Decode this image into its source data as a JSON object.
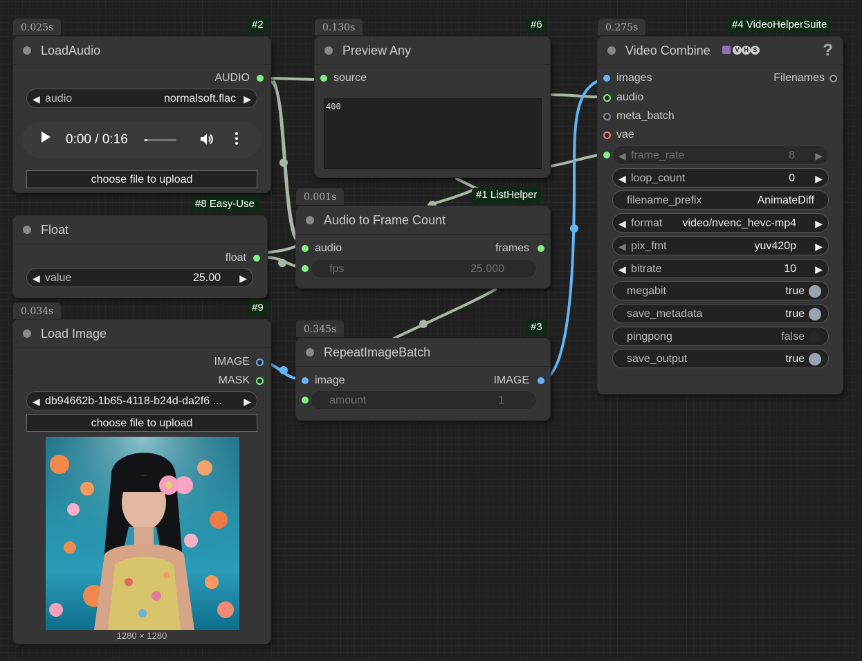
{
  "nodes": {
    "load_audio": {
      "time": "0.025s",
      "badge": "#2",
      "title": "LoadAudio",
      "output": "AUDIO",
      "audio_label": "audio",
      "audio_value": "normalsoft.flac",
      "player_time": "0:00 / 0:16",
      "upload_label": "choose file to upload"
    },
    "preview_any": {
      "time": "0.130s",
      "badge": "#6",
      "title": "Preview Any",
      "input": "source",
      "text": "400"
    },
    "float": {
      "badge": "#8 Easy-Use",
      "title": "Float",
      "output": "float",
      "value_label": "value",
      "value": "25.00"
    },
    "audio_to_frame": {
      "time": "0.001s",
      "badge": "#1 ListHelper",
      "title": "Audio to Frame Count",
      "input": "audio",
      "output": "frames",
      "fps_label": "fps",
      "fps_value": "25.000"
    },
    "load_image": {
      "time": "0.034s",
      "badge": "#9",
      "title": "Load Image",
      "output_image": "IMAGE",
      "output_mask": "MASK",
      "image_value": "db94662b-1b65-4118-b24d-da2f6 ...",
      "upload_label": "choose file to upload",
      "dimensions": "1280 × 1280"
    },
    "repeat_image": {
      "time": "0.345s",
      "badge": "#3",
      "title": "RepeatImageBatch",
      "input": "image",
      "output": "IMAGE",
      "amount_label": "amount",
      "amount_value": "1"
    },
    "video_combine": {
      "time": "0.275s",
      "badge": "#4 VideoHelperSuite",
      "title": "Video Combine",
      "help": "?",
      "inputs": [
        "images",
        "audio",
        "meta_batch",
        "vae"
      ],
      "output": "Filenames",
      "widgets": {
        "frame_rate": {
          "label": "frame_rate",
          "value": "8"
        },
        "loop_count": {
          "label": "loop_count",
          "value": "0"
        },
        "filename_prefix": {
          "label": "filename_prefix",
          "value": "AnimateDiff"
        },
        "format": {
          "label": "format",
          "value": "video/nvenc_hevc-mp4"
        },
        "pix_fmt": {
          "label": "pix_fmt",
          "value": "yuv420p"
        },
        "bitrate": {
          "label": "bitrate",
          "value": "10"
        },
        "megabit": {
          "label": "megabit",
          "value": "true"
        },
        "save_metadata": {
          "label": "save_metadata",
          "value": "true"
        },
        "pingpong": {
          "label": "pingpong",
          "value": "false"
        },
        "save_output": {
          "label": "save_output",
          "value": "true"
        }
      }
    }
  },
  "colors": {
    "canvas": "#202020",
    "node": "#353535",
    "badge": "#0d2a14",
    "link_audio": "#a8b8a4",
    "link_image": "#64b5f6",
    "slot_green": "#7ff27f",
    "slot_blue": "#6eb0f5",
    "slot_red": "#f37a7a"
  }
}
